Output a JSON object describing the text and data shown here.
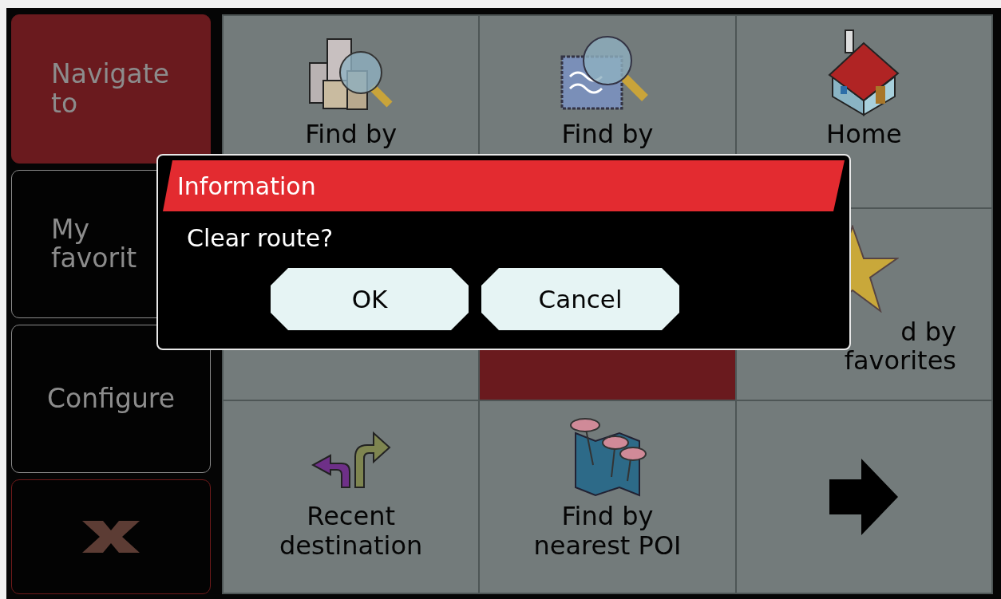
{
  "sidebar": {
    "items": [
      {
        "label": "Navigate to",
        "selected": true
      },
      {
        "label": "My favorit",
        "selected": false
      },
      {
        "label": "Configure",
        "selected": false
      }
    ]
  },
  "grid": {
    "cells": [
      {
        "kind": "city",
        "label_lines": [
          "Find by"
        ],
        "selected": false
      },
      {
        "kind": "zip",
        "label_lines": [
          "Find by"
        ],
        "selected": false
      },
      {
        "kind": "home",
        "label_lines": [
          "Home"
        ],
        "selected": false
      },
      {
        "kind": "blank",
        "selected": false
      },
      {
        "kind": "blank",
        "selected": true
      },
      {
        "kind": "favorites",
        "label_lines": [
          "d by",
          "favorites"
        ],
        "selected": false
      },
      {
        "kind": "recent",
        "label_lines": [
          "Recent",
          "destination"
        ],
        "selected": false
      },
      {
        "kind": "poi",
        "label_lines": [
          "Find by",
          "nearest POI"
        ],
        "selected": false
      },
      {
        "kind": "next",
        "selected": false
      }
    ]
  },
  "dialog": {
    "title": "Information",
    "message": "Clear route?",
    "buttons": [
      "OK",
      "Cancel"
    ]
  }
}
